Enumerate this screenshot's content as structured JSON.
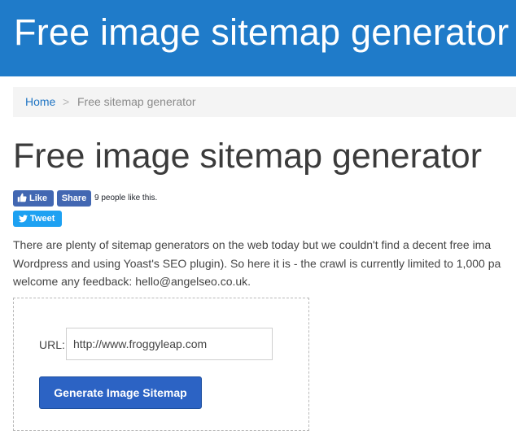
{
  "header": {
    "title": "Free image sitemap generator",
    "background_color": "#1f7bc9"
  },
  "breadcrumb": {
    "home": "Home",
    "separator": ">",
    "current": "Free sitemap generator"
  },
  "page": {
    "title": "Free image sitemap generator"
  },
  "social": {
    "like_label": "Like",
    "share_label": "Share",
    "like_count_text": "9 people like this.",
    "tweet_label": "Tweet",
    "facebook_color": "#4267b2",
    "twitter_color": "#1da1f2"
  },
  "intro": {
    "lines": [
      "There are plenty of sitemap generators on the web today but we couldn't find a decent free ima",
      "Wordpress and using Yoast's SEO plugin). So here it is - the crawl is currently limited to 1,000 pa",
      "welcome any feedback: hello@angelseo.co.uk."
    ]
  },
  "form": {
    "url_label": "URL:",
    "url_value": "http://www.froggyleap.com",
    "submit_label": "Generate Image Sitemap",
    "button_color": "#2c63c4"
  }
}
